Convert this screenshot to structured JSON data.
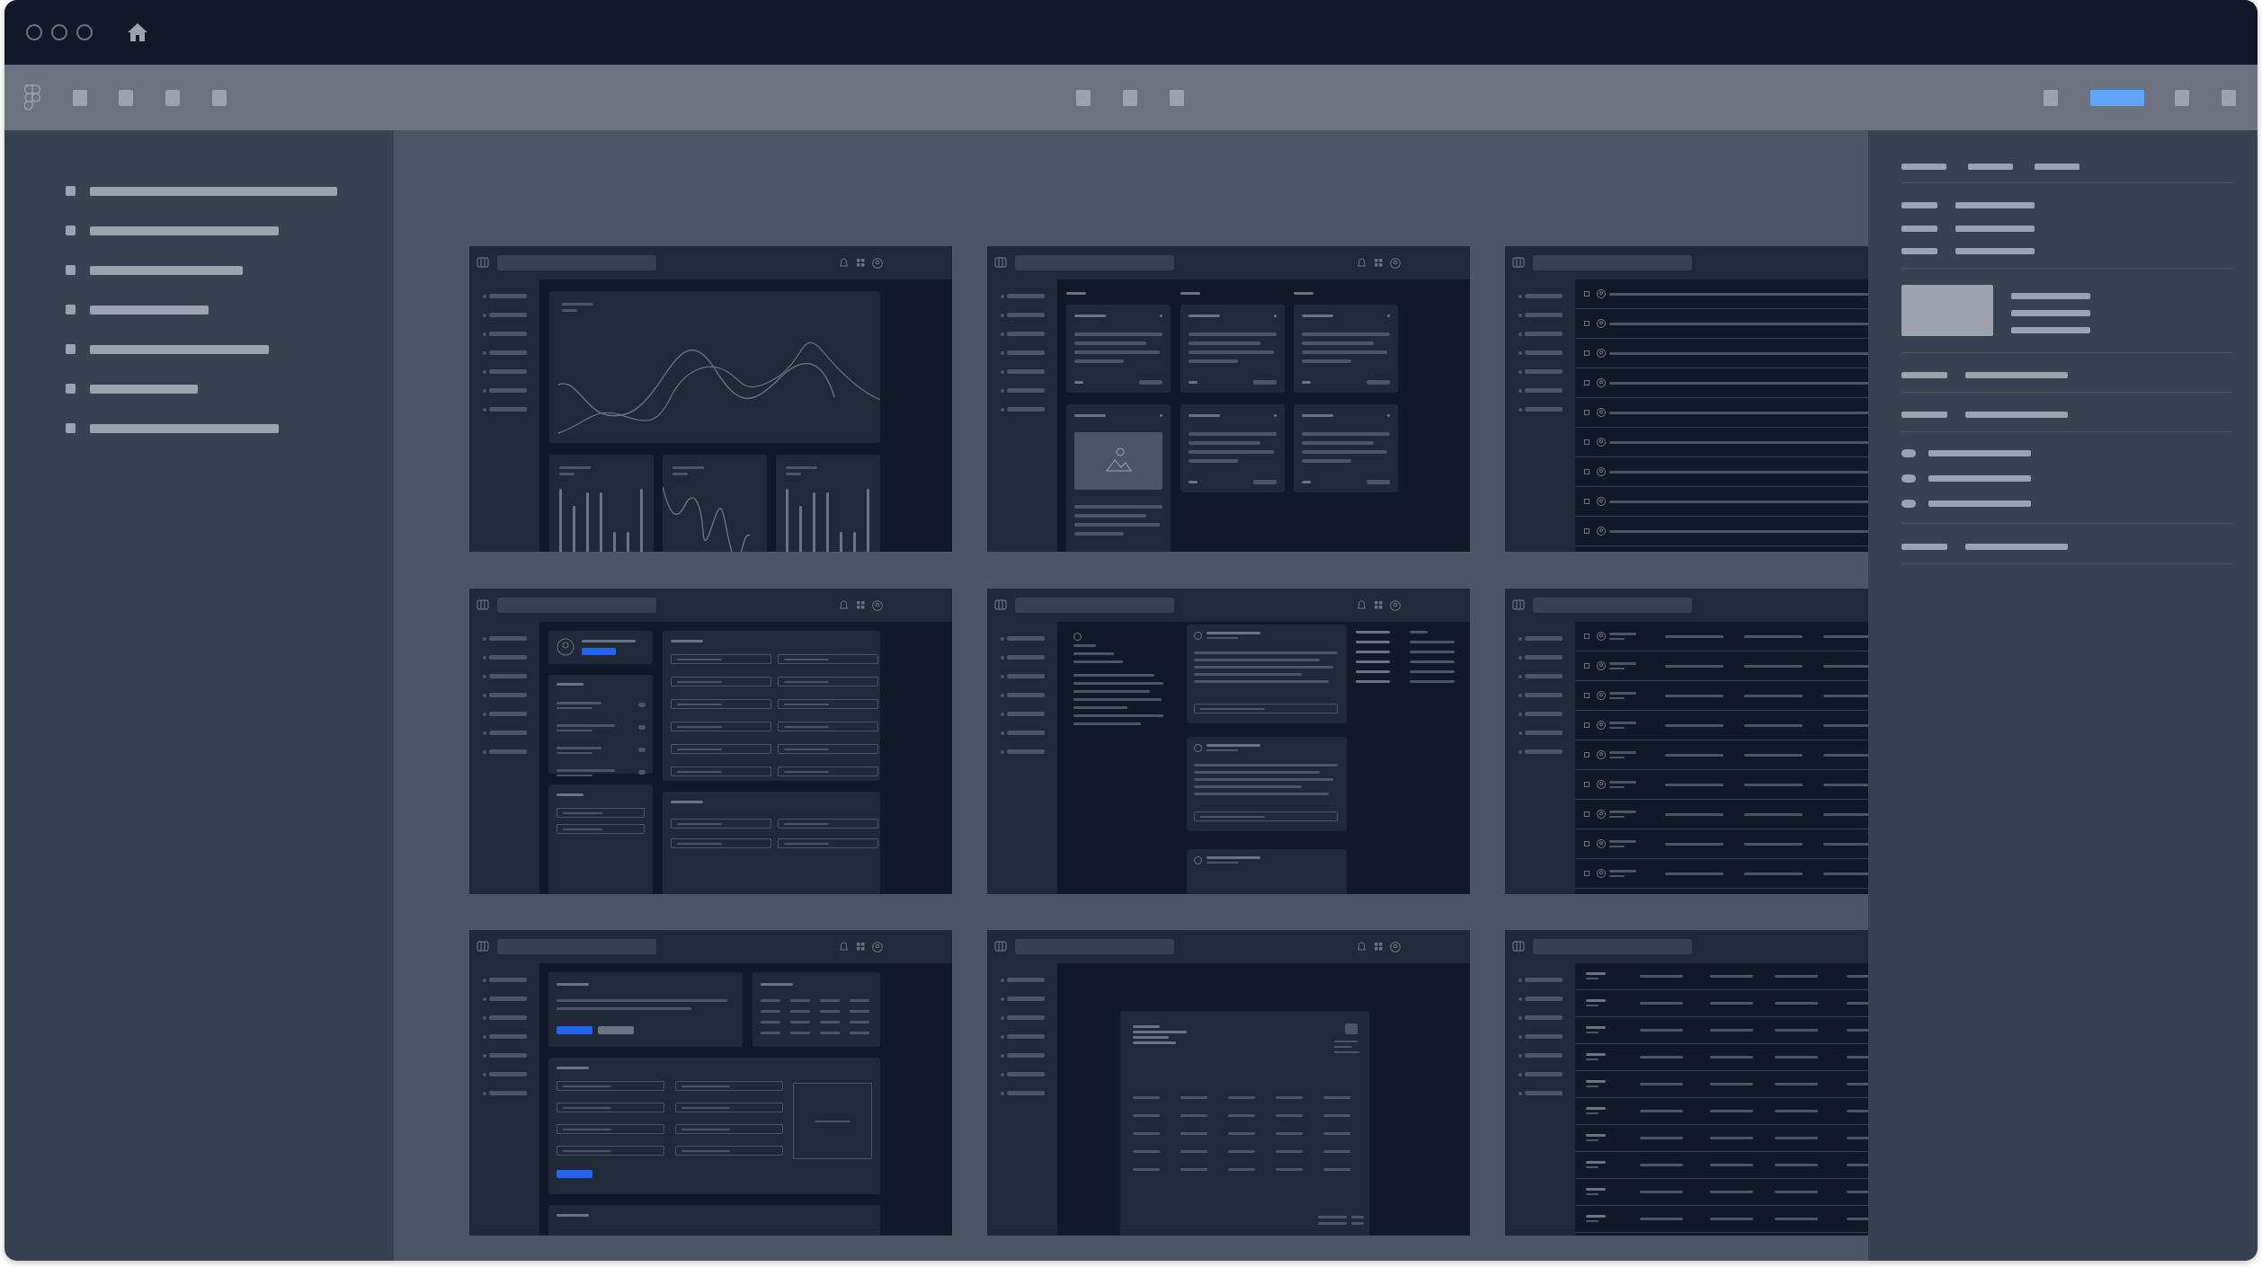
{
  "window": {
    "controls": [
      "close-button",
      "minimize-button",
      "maximize-button"
    ],
    "home_icon": "home-icon"
  },
  "toolbar": {
    "logo_icon": "figma-logo-icon",
    "left_tools": [
      "tool-1",
      "tool-2",
      "tool-3",
      "tool-4"
    ],
    "center_tools": [
      "tool-5",
      "tool-6",
      "tool-7"
    ],
    "right_tools": [
      "tool-8",
      "share-button",
      "tool-9",
      "tool-10"
    ],
    "active_color": "#60a5fa"
  },
  "left_sidebar": {
    "items": [
      {
        "name": "layer-item-1"
      },
      {
        "name": "layer-item-2"
      },
      {
        "name": "layer-item-3"
      },
      {
        "name": "layer-item-4"
      },
      {
        "name": "layer-item-5"
      },
      {
        "name": "layer-item-6"
      },
      {
        "name": "layer-item-7"
      }
    ]
  },
  "canvas": {
    "screens": [
      {
        "name": "screen-dashboard",
        "type": "dashboard"
      },
      {
        "name": "screen-kanban",
        "type": "kanban"
      },
      {
        "name": "screen-list",
        "type": "list"
      },
      {
        "name": "screen-settings",
        "type": "settings"
      },
      {
        "name": "screen-messages",
        "type": "messages"
      },
      {
        "name": "screen-user-table",
        "type": "usertable"
      },
      {
        "name": "screen-form",
        "type": "form"
      },
      {
        "name": "screen-document",
        "type": "document"
      },
      {
        "name": "screen-data-table",
        "type": "datatable"
      }
    ],
    "screen_header_icons": [
      "columns-icon",
      "bell-icon",
      "grid-icon",
      "user-circle-icon"
    ]
  },
  "right_panel": {
    "tabs": 3,
    "radio_options": 3,
    "selected_radio": null
  },
  "colors": {
    "titlebar": "#111827",
    "toolbar": "#6b7280",
    "panel": "#374151",
    "canvas": "#4b5563",
    "placeholder": "#9ca3af",
    "screen_chrome": "#1f2937",
    "screen_body": "#111827",
    "screen_accent": "#2563eb"
  }
}
